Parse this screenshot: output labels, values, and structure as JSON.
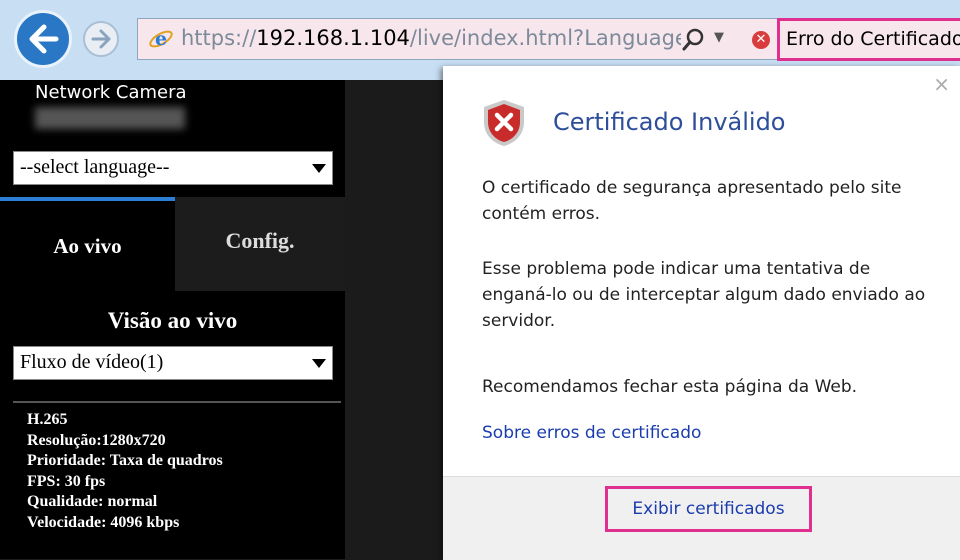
{
  "browser": {
    "url_host_prefix": "https://",
    "url_host": "192.168.1.104",
    "url_path": "/live/index.html?Language=",
    "cert_error_label": "Erro do Certificado",
    "icons": [
      "back-arrow-icon",
      "forward-arrow-icon",
      "ie-logo-icon",
      "search-icon",
      "dropdown-icon",
      "error-icon"
    ]
  },
  "camera_page": {
    "title": "Network Camera",
    "language_select": "--select language--",
    "tab_live": "Ao vivo",
    "tab_config": "Config.",
    "live_view_heading": "Visão ao vivo",
    "stream_select": "Fluxo de vídeo(1)",
    "info_lines": [
      "H.265",
      "Resolução:1280x720",
      "Prioridade: Taxa de quadros",
      "FPS: 30 fps",
      "Qualidade: normal",
      "Velocidade:  4096 kbps"
    ]
  },
  "cert_popup": {
    "close": "×",
    "title": "Certificado Inválido",
    "paragraph1": "O certificado de segurança apresentado pelo site contém erros.",
    "paragraph2": "Esse problema pode indicar uma tentativa de enganá-lo ou de interceptar algum dado enviado ao servidor.",
    "paragraph3": "Recomendamos fechar esta página da Web.",
    "link": "Sobre erros de certificado",
    "button": "Exibir certificados"
  },
  "colors": {
    "highlight": "#e0308f",
    "link": "#1a3cae",
    "title": "#2d4e9a",
    "tab_accent": "#2d7ed6"
  }
}
